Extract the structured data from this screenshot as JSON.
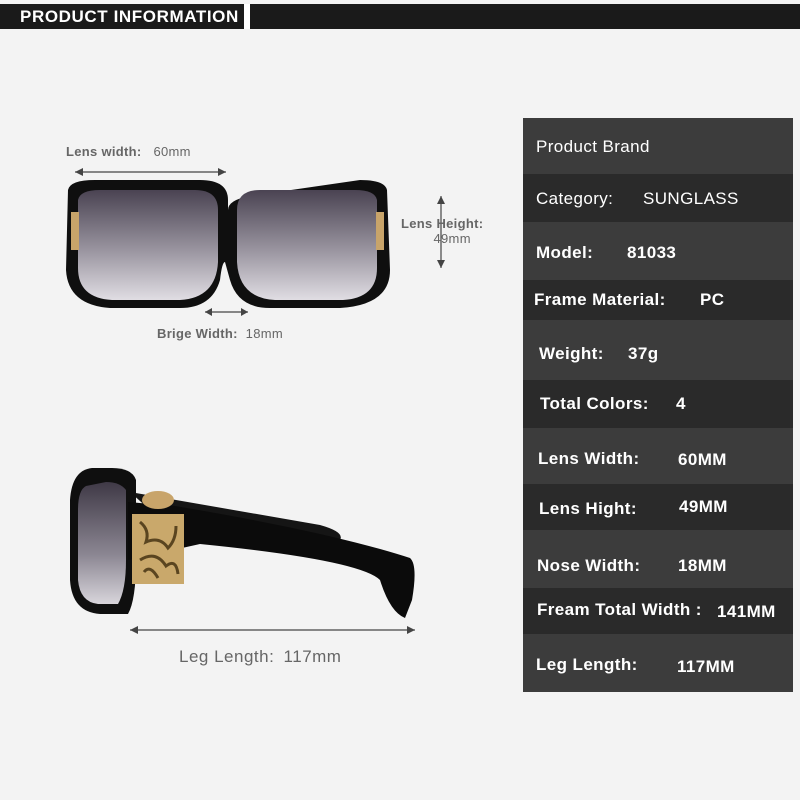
{
  "header": {
    "title": "PRODUCT INFORMATION"
  },
  "front_view": {
    "lens_width_label": "Lens width:",
    "lens_width_value": "60mm",
    "lens_height_label": "Lens Height:",
    "lens_height_value": "49mm",
    "bridge_width_label": "Brige Width:",
    "bridge_width_value": "18mm"
  },
  "side_view": {
    "leg_length_label": "Leg Length:",
    "leg_length_value": "117mm"
  },
  "specs": {
    "brand": "Product Brand",
    "rows": [
      {
        "label": "Category:",
        "value": "SUNGLASS"
      },
      {
        "label": "Model:",
        "value": "81033"
      },
      {
        "label": "Frame Material:",
        "value": "PC"
      },
      {
        "label": "Weight:",
        "value": "37g"
      },
      {
        "label": "Total Colors:",
        "value": "4"
      },
      {
        "label": "Lens Width:",
        "value": "60MM"
      },
      {
        "label": "Lens Hight:",
        "value": "49MM"
      },
      {
        "label": "Nose Width:",
        "value": "18MM"
      },
      {
        "label": "Fream Total Width :",
        "value": "141MM"
      },
      {
        "label": "Leg Length:",
        "value": "117MM"
      }
    ]
  },
  "colors": {
    "header_bg": "#1a1a1a",
    "table_bg": "#2e2e2e",
    "table_row_light": "#3c3c3c",
    "frame": "#111111",
    "lens_gradient_top": "#4a4352",
    "lens_gradient_bottom": "#d9d6dc",
    "hinge_gold": "#c8a46a"
  }
}
